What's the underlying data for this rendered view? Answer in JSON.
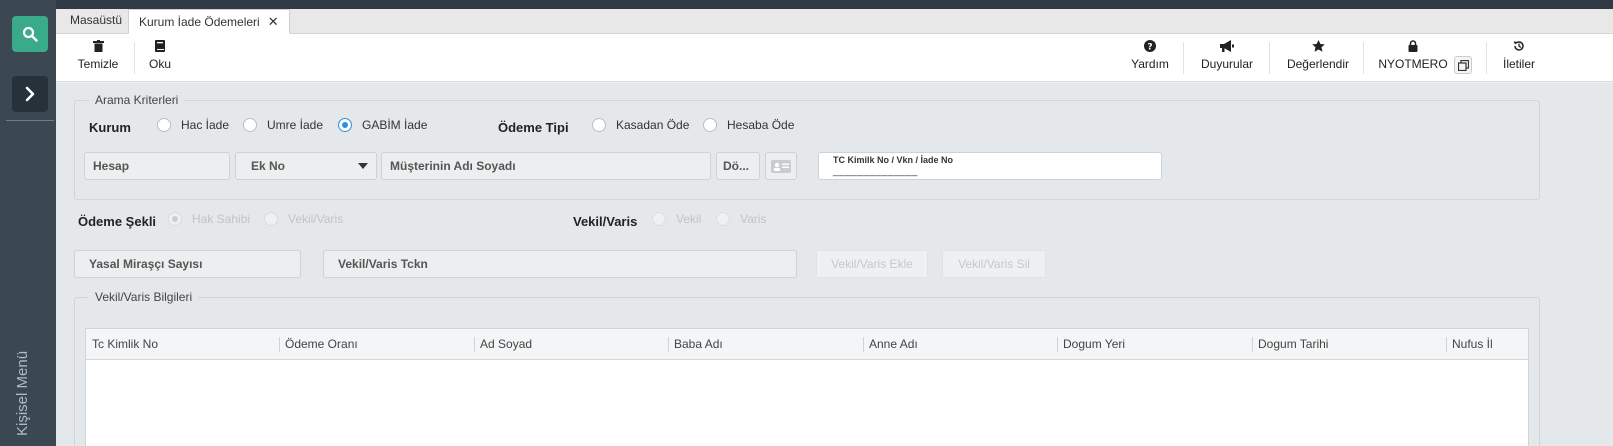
{
  "sidebar": {
    "personal_menu": "Kişisel Menü"
  },
  "tabs": [
    {
      "label": "Masaüstü"
    },
    {
      "label": "Kurum İade Ödemeleri",
      "close": "✕"
    }
  ],
  "toolbar": {
    "left": [
      {
        "label": "Temizle",
        "icon": "trash-icon"
      },
      {
        "label": "Oku",
        "icon": "book-icon"
      }
    ],
    "right": [
      {
        "label": "Yardım",
        "icon": "question-icon"
      },
      {
        "label": "Duyurular",
        "icon": "megaphone-icon"
      },
      {
        "label": "Değerlendir",
        "icon": "star-icon"
      },
      {
        "label": "NYOTMERO",
        "icon": "lock-icon"
      },
      {
        "label": "İletiler",
        "icon": "history-icon"
      }
    ]
  },
  "search_criteria": {
    "legend": "Arama Kriterleri",
    "kurum_label": "Kurum",
    "kurum_options": [
      "Hac İade",
      "Umre İade",
      "GABİM İade"
    ],
    "kurum_selected": "GABİM İade",
    "odeme_tipi_label": "Ödeme Tipi",
    "odeme_tipi_options": [
      "Kasadan Öde",
      "Hesaba Öde"
    ],
    "hesap_placeholder": "Hesap",
    "ek_no_placeholder": "Ek No",
    "musteri_placeholder": "Müşterinin Adı Soyadı",
    "doviz_placeholder": "Dö...",
    "tc_label": "TC Kimilk No / Vkn / İade No",
    "tc_mask": "______________"
  },
  "payment": {
    "odeme_sekli_label": "Ödeme Şekli",
    "odeme_sekli_options": [
      "Hak Sahibi",
      "Vekil/Varis"
    ],
    "vekil_label": "Vekil/Varis",
    "vekil_options": [
      "Vekil",
      "Varis"
    ],
    "mirasci_placeholder": "Yasal Miraşçı Sayısı",
    "vekil_tckn_placeholder": "Vekil/Varis Tckn",
    "add_button": "Vekil/Varis Ekle",
    "delete_button": "Vekil/Varis Sil"
  },
  "vekil_grid": {
    "legend": "Vekil/Varis Bilgileri",
    "columns": [
      "Tc Kimlik No",
      "Ödeme Oranı",
      "Ad Soyad",
      "Baba Adı",
      "Anne Adı",
      "Dogum Yeri",
      "Dogum Tarihi",
      "Nufus İl"
    ]
  },
  "colors": {
    "accent_green": "#3aab8a",
    "radio_blue": "#2d8fe0",
    "sidebar_bg": "#3b4751"
  }
}
